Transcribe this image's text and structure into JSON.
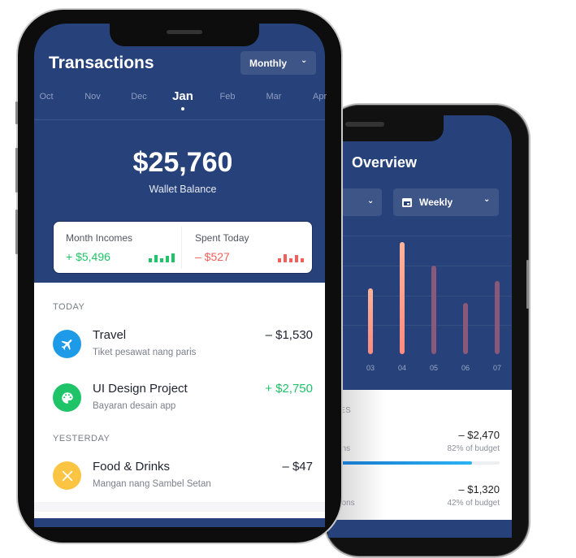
{
  "overview": {
    "title": "Overview",
    "weekly_label": "Weekly",
    "chart_data": {
      "type": "bar",
      "categories": [
        "03",
        "04",
        "05",
        "06",
        "07"
      ],
      "values": [
        59,
        100,
        79,
        46,
        65
      ],
      "highlighted": [
        "03",
        "04"
      ],
      "colors": {
        "active": "#ff8a80",
        "inactive": "#8a5878"
      }
    },
    "section_label": "ES",
    "budgets": [
      {
        "amount": "– $2,470",
        "label": "ctions",
        "percent_label": "82% of budget",
        "progress": 82
      },
      {
        "amount": "– $1,320",
        "label": "actions",
        "percent_label": "42% of budget",
        "progress": 42
      }
    ]
  },
  "transactions": {
    "title": "Transactions",
    "period_label": "Monthly",
    "months": [
      "Oct",
      "Nov",
      "Dec",
      "Jan",
      "Feb",
      "Mar",
      "Apr"
    ],
    "selected_month": "Jan",
    "balance": "$25,760",
    "balance_label": "Wallet Balance",
    "income_label": "Month Incomes",
    "income_value": "+ $5,496",
    "spent_label": "Spent Today",
    "spent_value": "– $527",
    "sections": [
      {
        "label": "TODAY",
        "items": [
          {
            "title": "Travel",
            "subtitle": "Tiket pesawat nang paris",
            "amount": "– $1,530",
            "icon": "airplane-icon",
            "color": "#1e9be8",
            "positive": false
          },
          {
            "title": "UI Design Project",
            "subtitle": "Bayaran desain app",
            "amount": "+ $2,750",
            "icon": "palette-icon",
            "color": "#1ec467",
            "positive": true
          }
        ]
      },
      {
        "label": "YESTERDAY",
        "items": [
          {
            "title": "Food & Drinks",
            "subtitle": "Mangan nang Sambel Setan",
            "amount": "– $47",
            "icon": "utensils-icon",
            "color": "#fcc443",
            "positive": false
          }
        ]
      }
    ],
    "colors": {
      "primary": "#27427a",
      "positive": "#1ec467",
      "negative": "#f2605c"
    }
  }
}
